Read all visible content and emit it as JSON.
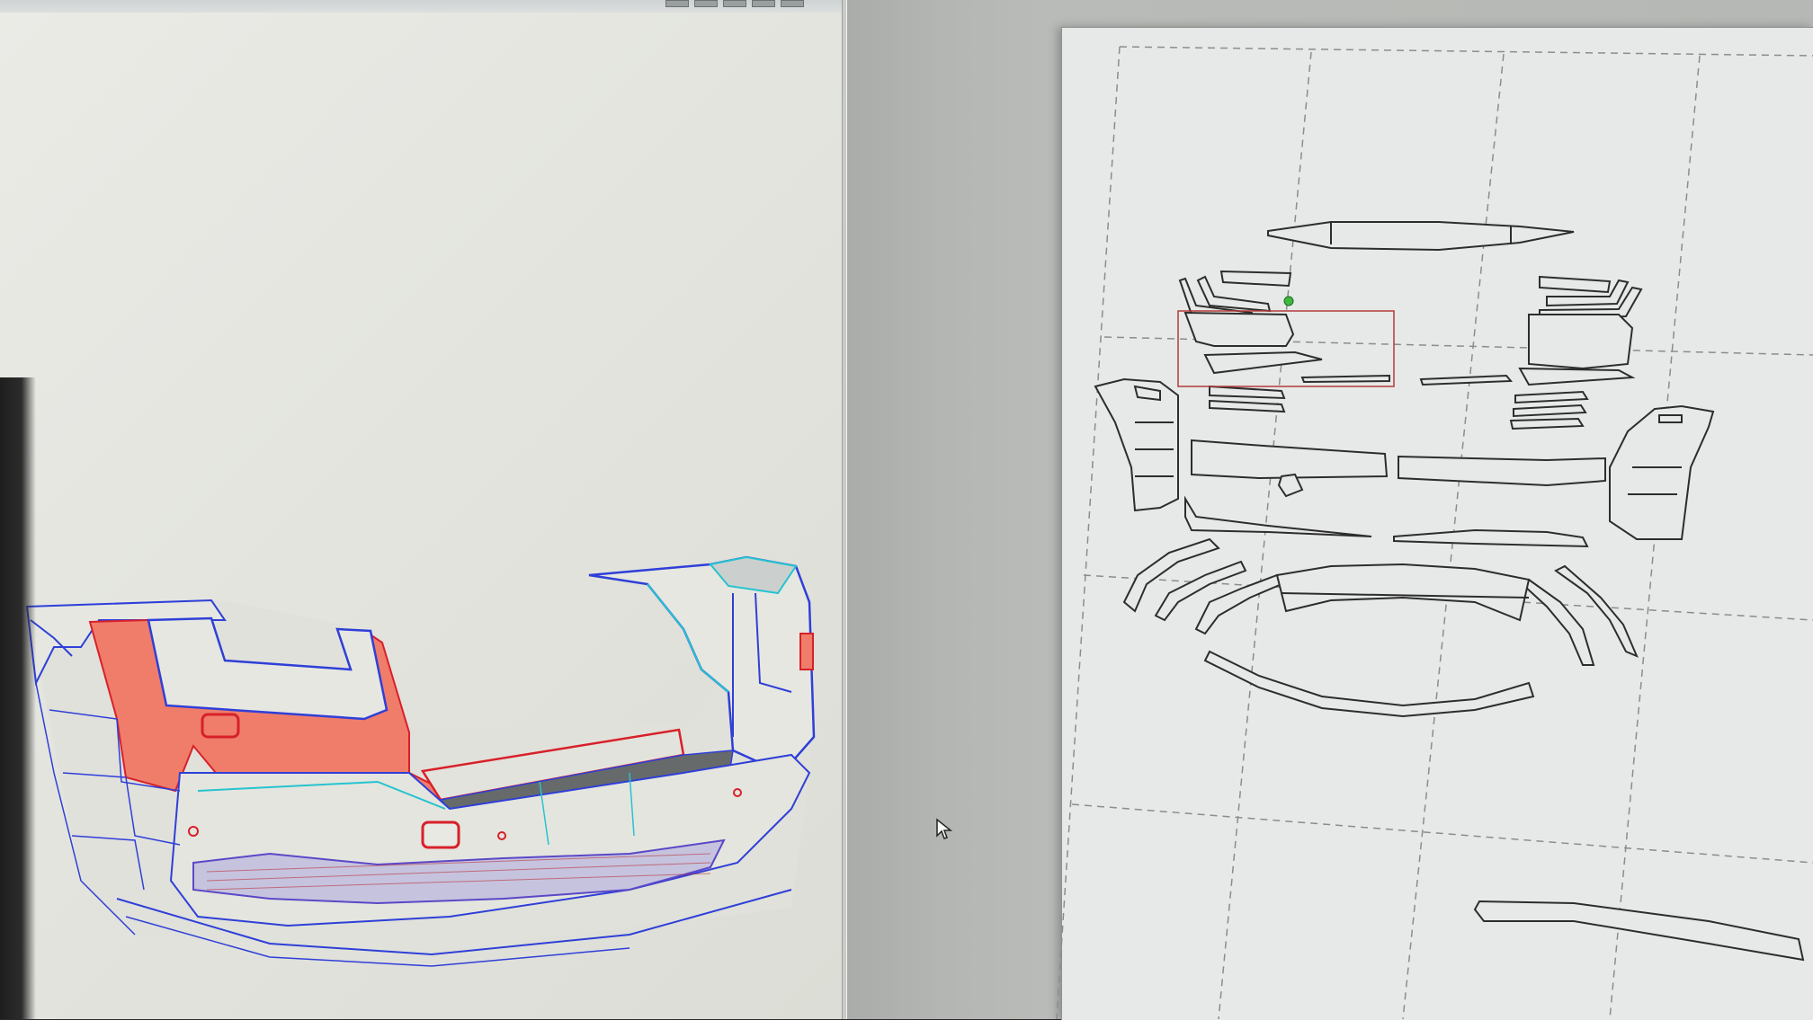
{
  "window": {
    "left_panel": "3d-model-view",
    "right_panel": "unfolded-pattern-layout",
    "toolbar_icons": [
      "tool-icon",
      "tool-icon",
      "tool-icon",
      "tool-icon",
      "tool-icon"
    ]
  },
  "colors": {
    "model_fill": "#e2e3dc",
    "selected_face": "#ef7d6a",
    "edge_blue": "#2f3fd8",
    "edge_cyan": "#26c3d0",
    "edge_red": "#d8202a",
    "sheet_bg": "#e7e9e8",
    "grid_dash": "#8a8d8c",
    "selection_box": "#b23a3a",
    "selection_handle": "#3fb83f"
  },
  "icons": {
    "cursor": "mouse-pointer-icon"
  }
}
